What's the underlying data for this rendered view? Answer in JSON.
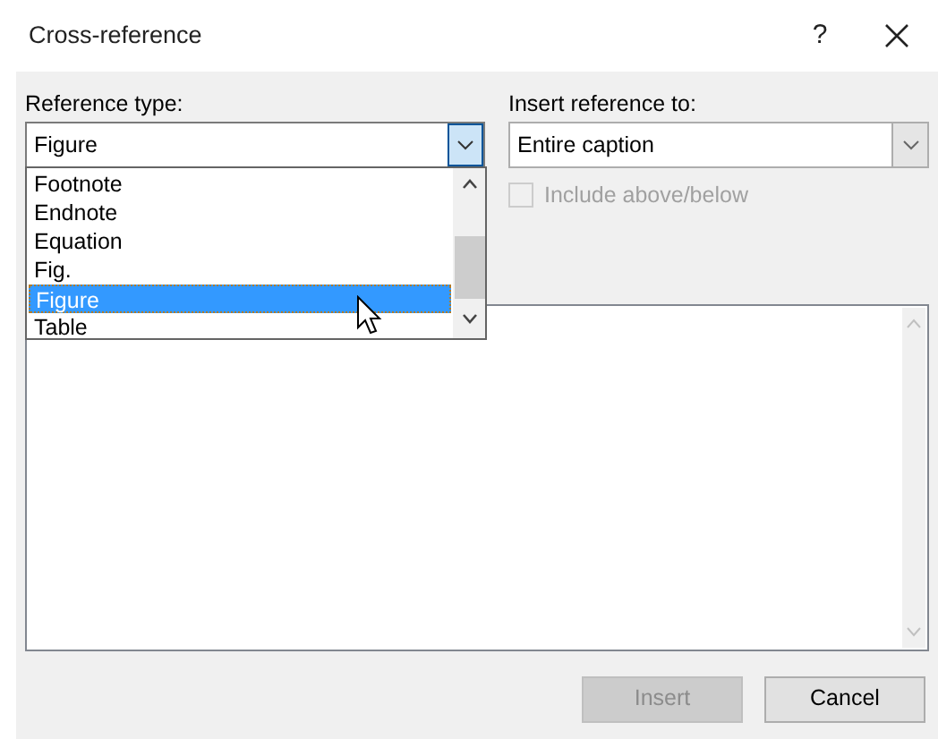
{
  "window": {
    "title": "Cross-reference",
    "help": "?"
  },
  "reference_type": {
    "label": "Reference type:",
    "value": "Figure",
    "expanded": true,
    "options": [
      {
        "label": "Footnote",
        "selected": false
      },
      {
        "label": "Endnote",
        "selected": false
      },
      {
        "label": "Equation",
        "selected": false
      },
      {
        "label": "Fig.",
        "selected": false
      },
      {
        "label": "Figure",
        "selected": true
      },
      {
        "label": "Table",
        "selected": false
      }
    ]
  },
  "insert_reference_to": {
    "label": "Insert reference to:",
    "value": "Entire caption"
  },
  "include_above_below": {
    "label": "Include above/below",
    "checked": false,
    "disabled": true
  },
  "buttons": [
    {
      "label": "Insert",
      "disabled": true
    },
    {
      "label": "Cancel",
      "disabled": false
    }
  ]
}
